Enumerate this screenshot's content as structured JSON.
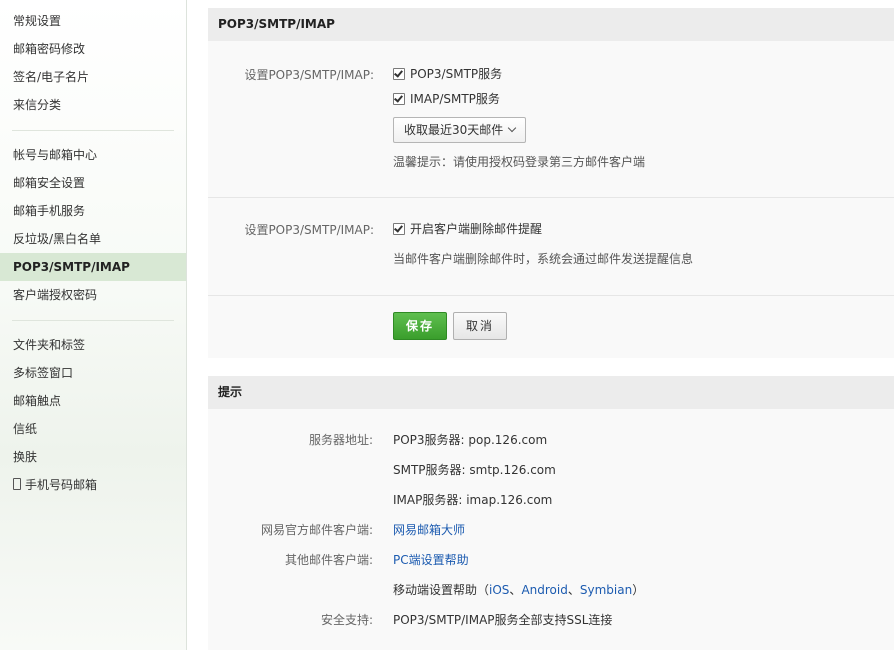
{
  "sidebar": {
    "group1": [
      "常规设置",
      "邮箱密码修改",
      "签名/电子名片",
      "来信分类"
    ],
    "group2": [
      "帐号与邮箱中心",
      "邮箱安全设置",
      "邮箱手机服务",
      "反垃圾/黑白名单",
      "POP3/SMTP/IMAP",
      "客户端授权密码"
    ],
    "group3": [
      "文件夹和标签",
      "多标签窗口",
      "邮箱触点",
      "信纸",
      "换肤",
      "手机号码邮箱"
    ],
    "active": "POP3/SMTP/IMAP"
  },
  "settings": {
    "title": "POP3/SMTP/IMAP",
    "label1": "设置POP3/SMTP/IMAP:",
    "pop3_smtp": "POP3/SMTP服务",
    "imap_smtp": "IMAP/SMTP服务",
    "fetch_select": "收取最近30天邮件",
    "hint": "温馨提示：请使用授权码登录第三方邮件客户端",
    "label2": "设置POP3/SMTP/IMAP:",
    "delete_reminder": "开启客户端删除邮件提醒",
    "delete_note": "当邮件客户端删除邮件时，系统会通过邮件发送提醒信息",
    "save": "保存",
    "cancel": "取消"
  },
  "tips": {
    "title": "提示",
    "server_label": "服务器地址:",
    "pop3": "POP3服务器: pop.126.com",
    "smtp": "SMTP服务器: smtp.126.com",
    "imap": "IMAP服务器: imap.126.com",
    "official_label": "网易官方邮件客户端:",
    "official_link": "网易邮箱大师",
    "other_label": "其他邮件客户端:",
    "pc_help": "PC端设置帮助",
    "mobile_prefix": "移动端设置帮助（",
    "ios": "iOS",
    "sep": "、",
    "android": "Android",
    "symbian": "Symbian",
    "mobile_suffix": "）",
    "security_label": "安全支持:",
    "security_text": "POP3/SMTP/IMAP服务全部支持SSL连接"
  },
  "colors": {
    "accent_green": "#3a9e2c",
    "link_blue": "#1c5bb0",
    "active_bg": "#d8e8d4"
  }
}
